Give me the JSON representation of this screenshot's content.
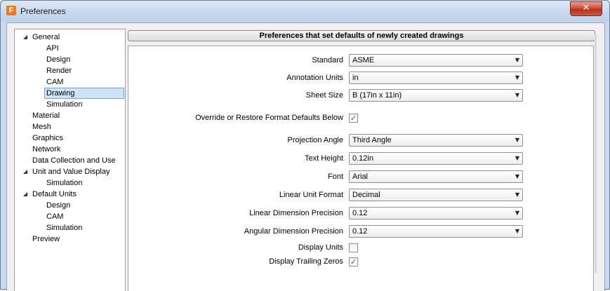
{
  "window": {
    "title": "Preferences",
    "app_icon_letter": "F",
    "close_glyph": "✕"
  },
  "tree": {
    "items": [
      {
        "label": "General",
        "expanded": true
      },
      {
        "label": "API"
      },
      {
        "label": "Design"
      },
      {
        "label": "Render"
      },
      {
        "label": "CAM"
      },
      {
        "label": "Drawing",
        "selected": true
      },
      {
        "label": "Simulation"
      },
      {
        "label": "Material"
      },
      {
        "label": "Mesh"
      },
      {
        "label": "Graphics"
      },
      {
        "label": "Network"
      },
      {
        "label": "Data Collection and Use"
      },
      {
        "label": "Unit and Value Display",
        "expanded": true
      },
      {
        "label": "Simulation"
      },
      {
        "label": "Default Units",
        "expanded": true
      },
      {
        "label": "Design"
      },
      {
        "label": "CAM"
      },
      {
        "label": "Simulation"
      },
      {
        "label": "Preview"
      }
    ],
    "expand_glyph": "◢"
  },
  "panel": {
    "header": "Preferences that set defaults of newly created drawings",
    "dropdown_glyph": "▼",
    "check_glyph": "✓",
    "fields": {
      "standard": {
        "label": "Standard",
        "value": "ASME"
      },
      "annotation_units": {
        "label": "Annotation Units",
        "value": "in"
      },
      "sheet_size": {
        "label": "Sheet Size",
        "value": "B (17in x 11in)"
      },
      "override": {
        "label": "Override or Restore Format Defaults Below",
        "checked": true
      },
      "projection_angle": {
        "label": "Projection Angle",
        "value": "Third Angle"
      },
      "text_height": {
        "label": "Text Height",
        "value": "0.12in"
      },
      "font": {
        "label": "Font",
        "value": "Arial"
      },
      "linear_unit_format": {
        "label": "Linear Unit Format",
        "value": "Decimal"
      },
      "linear_dimension_precision": {
        "label": "Linear Dimension Precision",
        "value": "0.12"
      },
      "angular_dimension_precision": {
        "label": "Angular Dimension Precision",
        "value": "0.12"
      },
      "display_units": {
        "label": "Display Units",
        "checked": false
      },
      "display_trailing_zeros": {
        "label": "Display Trailing Zeros",
        "checked": true
      }
    }
  }
}
